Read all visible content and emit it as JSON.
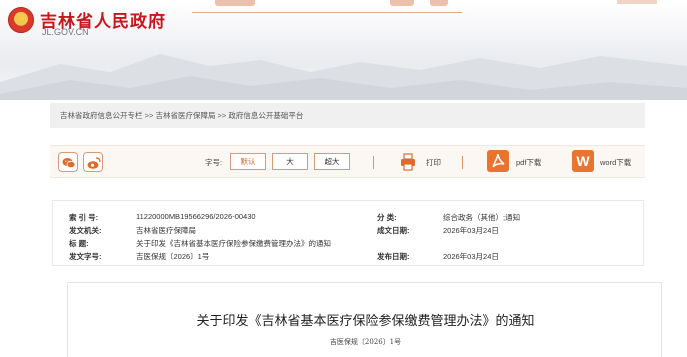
{
  "site": {
    "name_cn": "吉林省人民政府",
    "domain": "JL.GOV.CN"
  },
  "breadcrumb": {
    "items": [
      "吉林省政府信息公开专栏",
      "吉林省医疗保障局",
      "政府信息公开基础平台"
    ],
    "separator": ">>"
  },
  "toolbar": {
    "font_label": "字号:",
    "font_default": "默认",
    "font_large": "大",
    "font_xlarge": "超大",
    "print": "打印",
    "pdf": "pdf下载",
    "word": "word下载",
    "word_badge": "W"
  },
  "info": {
    "index_key": "索 引 号:",
    "index_val": "11220000MB19566296/2026-00430",
    "category_key": "分    类:",
    "category_val": "综合政务（其他）;通知",
    "issuer_key": "发文机关:",
    "issuer_val": "吉林省医疗保障局",
    "created_key": "成文日期:",
    "created_val": "2026年03月24日",
    "title_key": "标    题:",
    "title_val": "关于印发《吉林省基本医疗保险参保缴费管理办法》的通知",
    "docno_key": "发文字号:",
    "docno_val": "吉医保规〔2026〕1号",
    "published_key": "发布日期:",
    "published_val": "2026年03月24日"
  },
  "document": {
    "title": "关于印发《吉林省基本医疗保险参保缴费管理办法》的通知",
    "subtitle": "吉医保规〔2026〕1号"
  },
  "colors": {
    "brand_red": "#c8161d",
    "accent_orange": "#e06a2b",
    "border_orange": "#d89a75"
  }
}
